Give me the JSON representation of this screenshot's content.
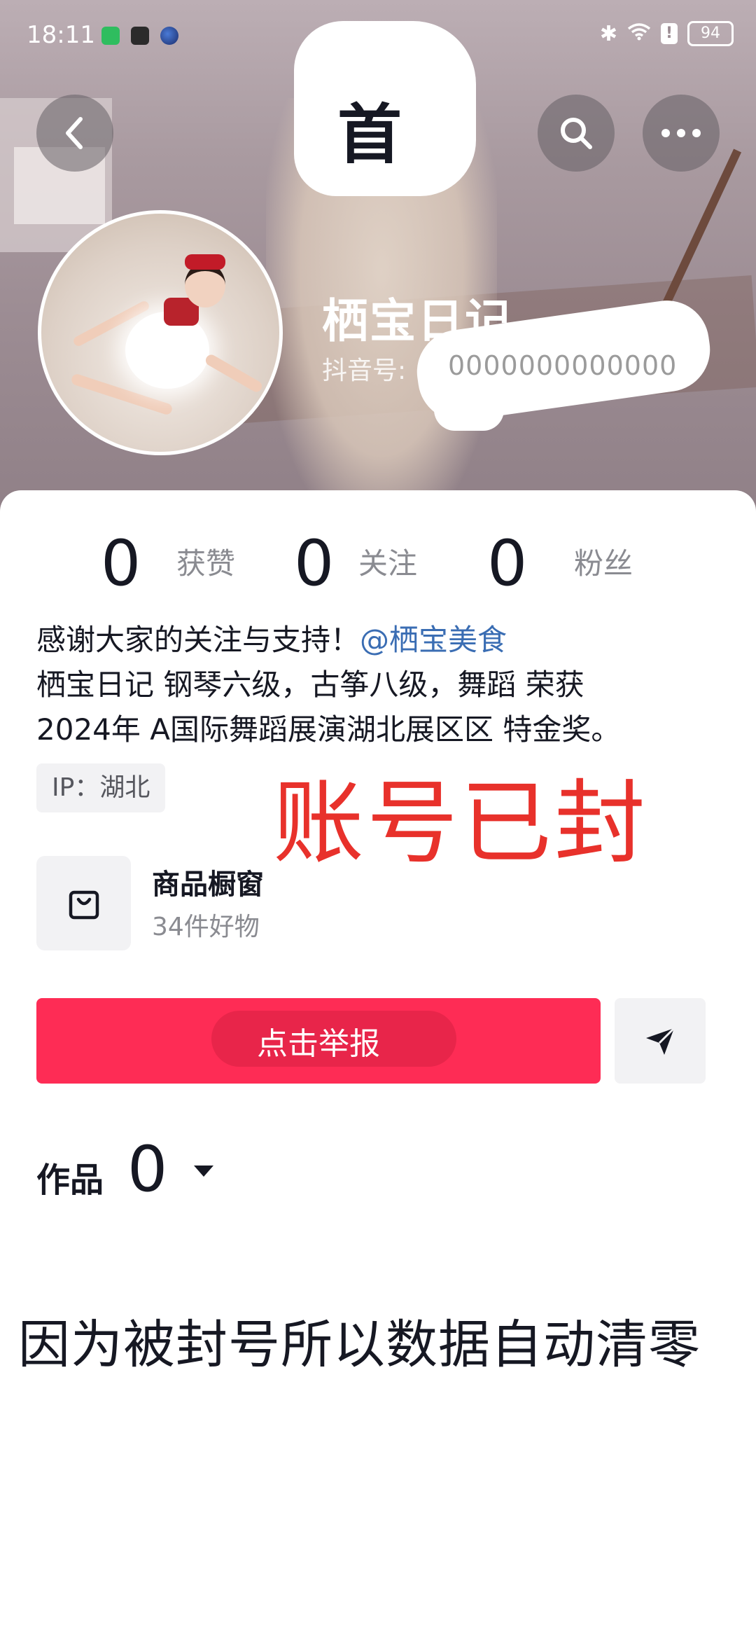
{
  "status_bar": {
    "time": "18:11",
    "battery": "94",
    "icons": [
      "wechat-icon",
      "video-icon",
      "globe-icon",
      "bluetooth-icon",
      "wifi-icon",
      "alert-icon",
      "battery-icon"
    ]
  },
  "nav": {
    "title_char": "首",
    "back_icon": "chevron-left-icon",
    "search_icon": "search-icon",
    "more_icon": "more-dots-icon"
  },
  "profile": {
    "nickname": "栖宝日记",
    "id_label": "抖音号:",
    "id_value": "0000000000000"
  },
  "stats": [
    {
      "value": "0",
      "label": "获赞"
    },
    {
      "value": "0",
      "label": "关注"
    },
    {
      "value": "0",
      "label": "粉丝"
    }
  ],
  "bio": {
    "line1_text": "感谢大家的关注与支持！",
    "line1_mention": "@栖宝美食",
    "line2": "栖宝日记 钢琴六级，古筝八级，舞蹈 荣获",
    "line3": "2024年 A国际舞蹈展演湖北展区区 特金奖。"
  },
  "ip": "IP：湖北",
  "stamp": "账号已封",
  "shop": {
    "title": "商品橱窗",
    "subtitle": "34件好物",
    "icon": "shopping-bag-icon"
  },
  "actions": {
    "report_label": "点击举报",
    "share_icon": "send-icon"
  },
  "works": {
    "label": "作品",
    "count": "0"
  },
  "caption": "因为被封号所以数据自动清零",
  "colors": {
    "accent": "#fe2c55",
    "stamp": "#e8312b",
    "text": "#161823",
    "muted": "#8a8b91"
  }
}
